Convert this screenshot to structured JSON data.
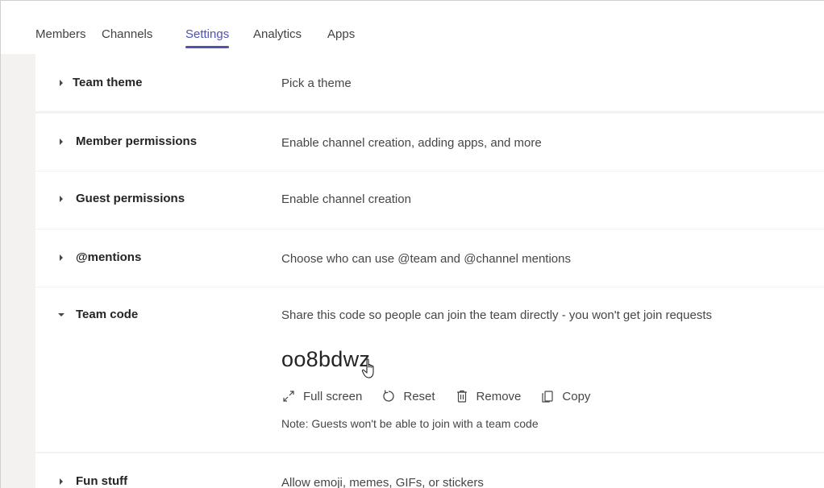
{
  "tabs": [
    {
      "label": "Members"
    },
    {
      "label": "Channels"
    },
    {
      "label": "Settings"
    },
    {
      "label": "Analytics"
    },
    {
      "label": "Apps"
    }
  ],
  "settings": [
    {
      "title": "Team theme",
      "description": "Pick a theme"
    },
    {
      "title": "Member permissions",
      "description": "Enable channel creation, adding apps, and more"
    },
    {
      "title": "Guest permissions",
      "description": "Enable channel creation"
    },
    {
      "title": "@mentions",
      "description": "Choose who can use @team and @channel mentions"
    },
    {
      "title": "Team code",
      "description": "Share this code so people can join the team directly - you won't get join requests"
    },
    {
      "title": "Fun stuff",
      "description": "Allow emoji, memes, GIFs, or stickers"
    }
  ],
  "team_code": {
    "code": "oo8bdwz",
    "actions": {
      "full_screen": "Full screen",
      "reset": "Reset",
      "remove": "Remove",
      "copy": "Copy"
    },
    "note": "Note: Guests won't be able to join with a team code"
  },
  "colors": {
    "accent": "#4f52b2",
    "background": "#f3f2f1"
  }
}
